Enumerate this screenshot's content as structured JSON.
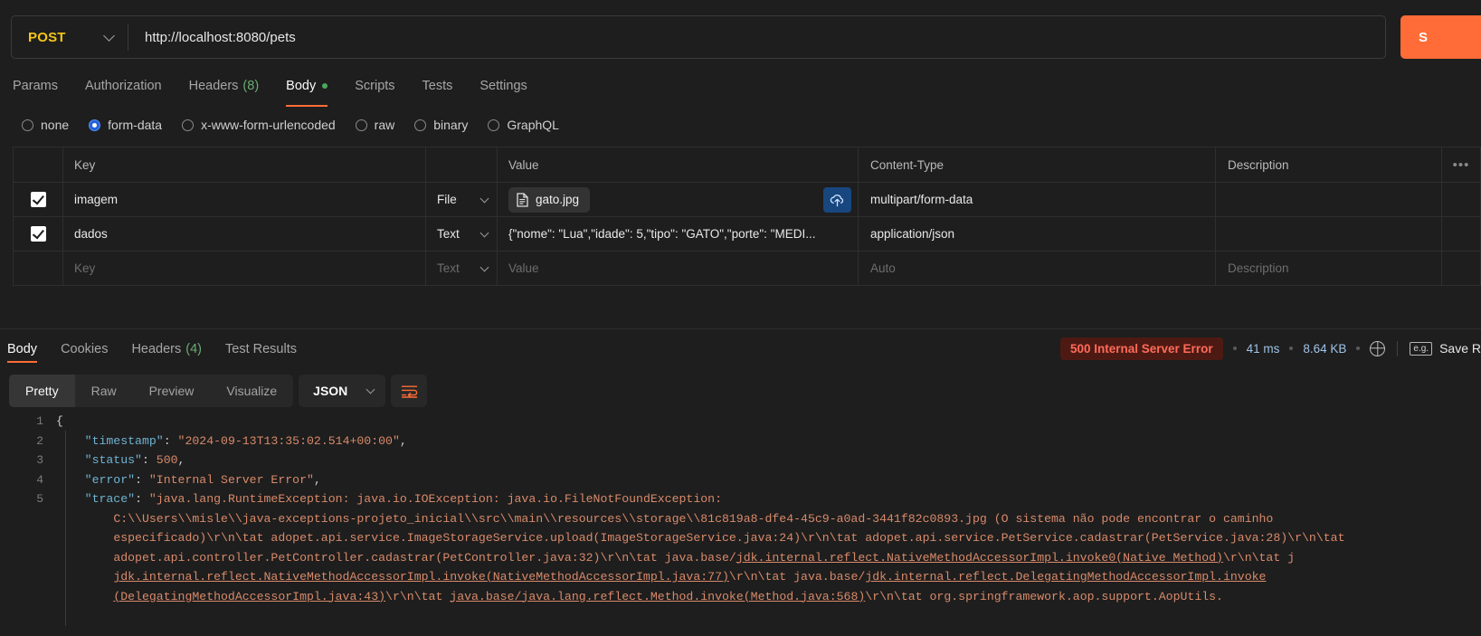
{
  "request": {
    "method": "POST",
    "url": "http://localhost:8080/pets",
    "send_label": "S",
    "tabs": [
      {
        "label": "Params",
        "count": "",
        "dot": false,
        "active": false
      },
      {
        "label": "Authorization",
        "count": "",
        "dot": false,
        "active": false
      },
      {
        "label": "Headers",
        "count": "(8)",
        "dot": false,
        "active": false
      },
      {
        "label": "Body",
        "count": "",
        "dot": true,
        "active": true
      },
      {
        "label": "Scripts",
        "count": "",
        "dot": false,
        "active": false
      },
      {
        "label": "Tests",
        "count": "",
        "dot": false,
        "active": false
      },
      {
        "label": "Settings",
        "count": "",
        "dot": false,
        "active": false
      }
    ],
    "body_types": [
      {
        "label": "none",
        "selected": false
      },
      {
        "label": "form-data",
        "selected": true
      },
      {
        "label": "x-www-form-urlencoded",
        "selected": false
      },
      {
        "label": "raw",
        "selected": false
      },
      {
        "label": "binary",
        "selected": false
      },
      {
        "label": "GraphQL",
        "selected": false
      }
    ]
  },
  "form_data": {
    "headers": {
      "key": "Key",
      "value": "Value",
      "content_type": "Content-Type",
      "description": "Description",
      "more": "•••"
    },
    "rows": [
      {
        "checked": true,
        "key": "imagem",
        "type": "File",
        "value": "gato.jpg",
        "is_file": true,
        "content_type": "multipart/form-data",
        "description": ""
      },
      {
        "checked": true,
        "key": "dados",
        "type": "Text",
        "value": "{\"nome\": \"Lua\",\"idade\": 5,\"tipo\": \"GATO\",\"porte\": \"MEDI...",
        "is_file": false,
        "content_type": "application/json",
        "description": ""
      }
    ],
    "placeholder_row": {
      "key": "Key",
      "type": "Text",
      "value": "Value",
      "content_type": "Auto",
      "description": "Description"
    }
  },
  "response": {
    "tabs": [
      {
        "label": "Body",
        "count": "",
        "active": true
      },
      {
        "label": "Cookies",
        "count": "",
        "active": false
      },
      {
        "label": "Headers",
        "count": "(4)",
        "active": false
      },
      {
        "label": "Test Results",
        "count": "",
        "active": false
      }
    ],
    "status": "500 Internal Server Error",
    "time": "41 ms",
    "size": "8.64 KB",
    "save_label": "Save R",
    "eg_label": "e.g.",
    "view_modes": [
      {
        "label": "Pretty",
        "active": true
      },
      {
        "label": "Raw",
        "active": false
      },
      {
        "label": "Preview",
        "active": false
      },
      {
        "label": "Visualize",
        "active": false
      }
    ],
    "format": "JSON"
  },
  "code": {
    "line_numbers": [
      "1",
      "2",
      "3",
      "4",
      "5"
    ],
    "json": {
      "open_brace": "{",
      "timestamp_key": "\"timestamp\"",
      "timestamp_value": "\"2024-09-13T13:35:02.514+00:00\"",
      "status_key": "\"status\"",
      "status_value": "500",
      "error_key": "\"error\"",
      "error_value": "\"Internal Server Error\"",
      "trace_key": "\"trace\"",
      "trace_l1": "\"java.lang.RuntimeException: java.io.IOException: java.io.FileNotFoundException:",
      "trace_l2": "C:\\\\Users\\\\misle\\\\java-exceptions-projeto_inicial\\\\src\\\\main\\\\resources\\\\storage\\\\81c819a8-dfe4-45c9-a0ad-3441f82c0893.jpg (O sistema não pode encontrar o caminho",
      "trace_l3": "especificado)\\r\\n\\tat adopet.api.service.ImageStorageService.upload(ImageStorageService.java:24)\\r\\n\\tat adopet.api.service.PetService.cadastrar(PetService.java:28)\\r\\n\\tat",
      "trace_l4a": "adopet.api.controller.PetController.cadastrar(PetController.java:32)\\r\\n\\tat java.base/",
      "trace_l4b": "jdk.internal.reflect.NativeMethodAccessorImpl.invoke0(Native Method)",
      "trace_l4c": "\\r\\n\\tat j",
      "trace_l5a": "jdk.internal.reflect.NativeMethodAccessorImpl.invoke(NativeMethodAccessorImpl.java:77)",
      "trace_l5b": "\\r\\n\\tat java.base/",
      "trace_l5c": "jdk.internal.reflect.DelegatingMethodAccessorImpl.invoke",
      "trace_l6a": "(DelegatingMethodAccessorImpl.java:43)",
      "trace_l6b": "\\r\\n\\tat ",
      "trace_l6c": "java.base/java.lang.reflect.Method.invoke(Method.java:568)",
      "trace_l6d": "\\r\\n\\tat org.springframework.aop.support.AopUtils."
    }
  },
  "icons": {
    "chevron_down": "chevron-down-icon",
    "file": "file-icon",
    "upload": "cloud-upload-icon",
    "globe": "globe-icon",
    "wrap": "wrap-lines-icon"
  },
  "colors": {
    "accent": "#ff6c37",
    "method": "#f5c518",
    "error_bg": "#4d1a13",
    "error_fg": "#ff6b5a",
    "json_key": "#6fb3d2",
    "json_string": "#d98a6a"
  }
}
